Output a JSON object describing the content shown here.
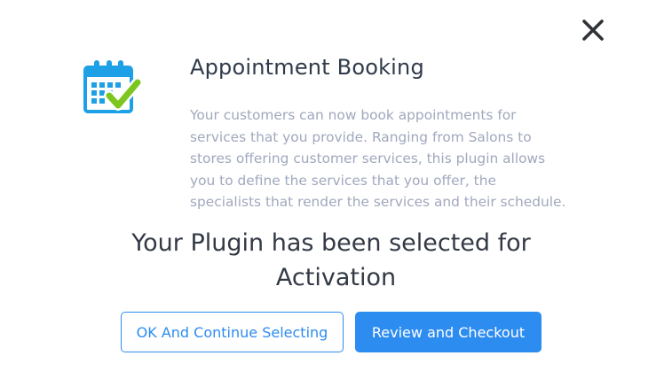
{
  "plugin": {
    "title": "Appointment Booking",
    "icon": "calendar-check-icon",
    "description_lines": [
      "Your customers can now book appointments for",
      "services that you provide. Ranging from Salons to",
      "stores offering customer services, this plugin allows",
      "you to define the services that you offer, the",
      "specialists that render the services and their schedule."
    ]
  },
  "message": {
    "line1": "Your Plugin has been selected for",
    "line2": "Activation"
  },
  "buttons": {
    "continue_label": "OK And Continue Selecting",
    "checkout_label": "Review and Checkout"
  },
  "close": {
    "icon": "close-icon"
  },
  "colors": {
    "accent": "#2d8cf0",
    "title": "#2f3b4a",
    "description": "#a0a8bd",
    "icon_blue": "#1ea0e6",
    "icon_check": "#7cc61f"
  }
}
